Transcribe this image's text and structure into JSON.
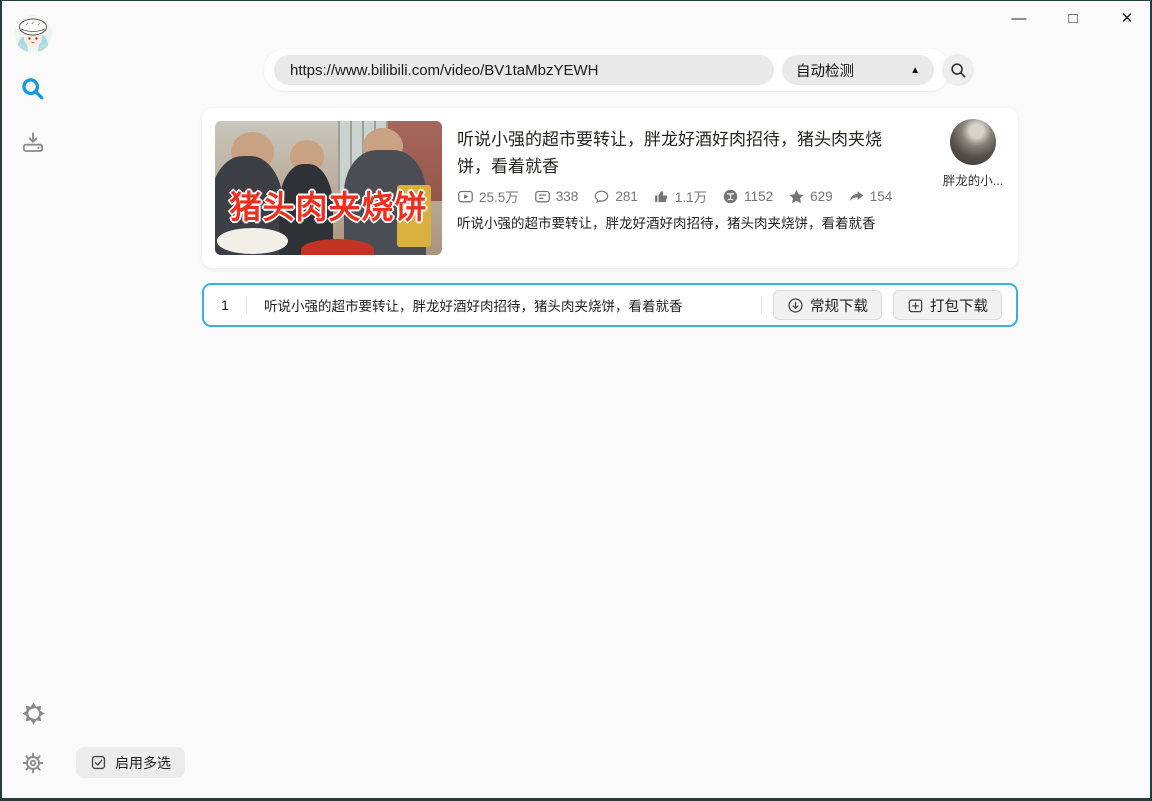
{
  "colors": {
    "accent_blue": "#3ab1e4",
    "sidebar_search_blue": "#1499e0",
    "frame_dark": "#20403a",
    "muted_gray": "#757575"
  },
  "window": {
    "minimize": "—",
    "maximize": "□",
    "close": "✕"
  },
  "topbar": {
    "url": "https://www.bilibili.com/video/BV1taMbzYEWH",
    "detect_label": "自动检测",
    "detect_caret": "▲"
  },
  "video_card": {
    "thumbnail_caption": "猪头肉夹烧饼",
    "title": "听说小强的超市要转让，胖龙好酒好肉招待，猪头肉夹烧饼，看着就香",
    "stats": [
      {
        "icon": "play-count-icon",
        "value": "25.5万"
      },
      {
        "icon": "danmaku-icon",
        "value": "338"
      },
      {
        "icon": "comment-icon",
        "value": "281"
      },
      {
        "icon": "like-icon",
        "value": "1.1万"
      },
      {
        "icon": "coin-icon",
        "value": "1152"
      },
      {
        "icon": "favorite-icon",
        "value": "629"
      },
      {
        "icon": "share-icon",
        "value": "154"
      }
    ],
    "description": "听说小强的超市要转让，胖龙好酒好肉招待，猪头肉夹烧饼，看着就香",
    "uploader_name": "胖龙的小..."
  },
  "download_row": {
    "index": "1",
    "title": "听说小强的超市要转让，胖龙好酒好肉招待，猪头肉夹烧饼，看着就香",
    "regular_label": "常规下载",
    "pack_label": "打包下载"
  },
  "footer": {
    "multi_select_label": "启用多选"
  }
}
